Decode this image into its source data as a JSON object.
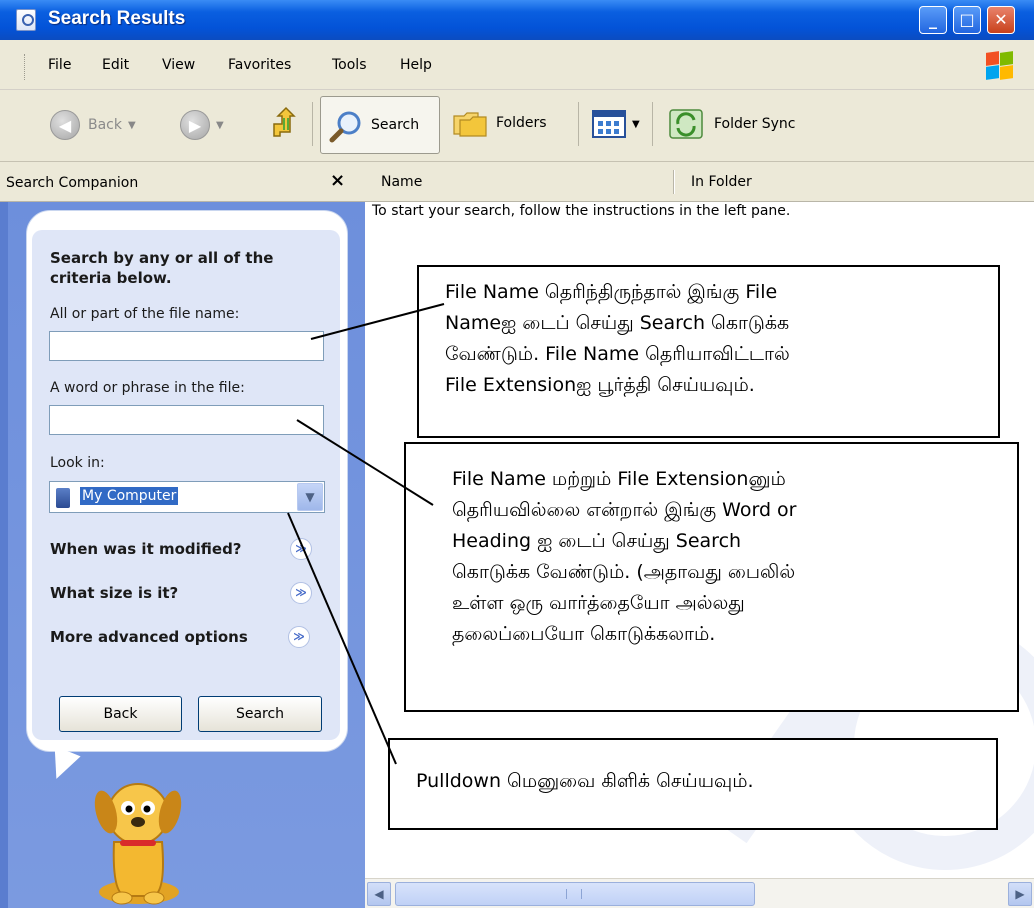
{
  "window": {
    "title": "Search Results"
  },
  "menu": {
    "file": "File",
    "edit": "Edit",
    "view": "View",
    "favorites": "Favorites",
    "tools": "Tools",
    "help": "Help"
  },
  "toolbar": {
    "back": "Back",
    "search": "Search",
    "folders": "Folders",
    "folder_sync": "Folder Sync"
  },
  "search_companion": {
    "title": "Search Companion",
    "close_glyph": "×",
    "heading": "Search by any or all of the criteria below.",
    "file_name_label": "All or part of the file name:",
    "file_name_value": "",
    "phrase_label": "A word or phrase in the file:",
    "phrase_value": "",
    "look_in_label": "Look in:",
    "look_in_value": "My Computer",
    "when_modified": "When was it modified?",
    "what_size": "What size is it?",
    "advanced": "More advanced options",
    "back_button": "Back",
    "search_button": "Search"
  },
  "results": {
    "col_name": "Name",
    "col_in_folder": "In Folder",
    "start_message": "To start your search, follow the instructions in the left pane."
  },
  "callouts": {
    "c1": "File Name தெரிந்திருந்தால் இங்கு File\nNameஐ டைப் செய்து Search கொடுக்க\nவேண்டும். File Name தெரியாவிட்டால்\nFile Extensionஐ பூர்த்தி செய்யவும்.",
    "c2": "File Name மற்றும் File Extensionனும்\nதெரியவில்லை என்றால் இங்கு Word or\nHeading ஐ டைப் செய்து Search\nகொடுக்க வேண்டும். (அதாவது பைலில்\nஉள்ள ஒரு வார்த்தையோ அல்லது\nதலைப்பையோ  கொடுக்கலாம்.",
    "c3": "Pulldown மெனுவை கிளிக் செய்யவும்."
  },
  "colors": {
    "title_bar": "#0353d8",
    "panel_blue": "#7b9ae0",
    "selection": "#316ac5"
  }
}
